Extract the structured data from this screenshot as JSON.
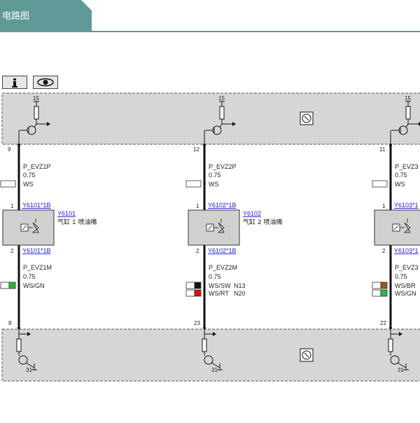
{
  "header": {
    "title": "电路图",
    "bar_color": "#5f9a98"
  },
  "toolbar": {
    "info_button": "i",
    "view_button": "eye-icon"
  },
  "top_module": {
    "supply_label": "15"
  },
  "bottom_module": {
    "ground_label": "31"
  },
  "circuits": [
    {
      "top_pin": "9",
      "wire_top_name": "P_EVZ1P",
      "wire_top_size": "0.75",
      "wire_top_color": "WS",
      "conn_top_pin": "1",
      "conn_top_ref": "Y6101*1B",
      "comp_ref": "Y6101",
      "comp_desc": "气缸 1 喷油嘴",
      "conn_bot_pin": "2",
      "conn_bot_ref": "Y6101*1B",
      "wire_bot_name": "P_EVZ1M",
      "wire_bot_size": "0.75",
      "wire_bot_colors": [
        {
          "code": "WS/GN",
          "swatch": "#22bb33",
          "net": ""
        }
      ],
      "bot_pin": "8"
    },
    {
      "top_pin": "12",
      "wire_top_name": "P_EVZ2P",
      "wire_top_size": "0.75",
      "wire_top_color": "WS",
      "conn_top_pin": "1",
      "conn_top_ref": "Y6102*1B",
      "comp_ref": "Y6102",
      "comp_desc": "气缸 2 喷油嘴",
      "conn_bot_pin": "2",
      "conn_bot_ref": "Y6102*1B",
      "wire_bot_name": "P_EVZ2M",
      "wire_bot_size": "0.75",
      "wire_bot_colors": [
        {
          "code": "WS/SW",
          "swatch": "#111111",
          "net": "N13"
        },
        {
          "code": "WS/RT",
          "swatch": "#dd1111",
          "net": "N20"
        }
      ],
      "bot_pin": "23"
    },
    {
      "top_pin": "11",
      "wire_top_name": "P_EVZ3",
      "wire_top_size": "0.75",
      "wire_top_color": "WS",
      "conn_top_pin": "1",
      "conn_top_ref": "Y6103*1",
      "comp_ref": "",
      "comp_desc": "",
      "conn_bot_pin": "2",
      "conn_bot_ref": "Y6103*1",
      "wire_bot_name": "P_EVZ3",
      "wire_bot_size": "0.75",
      "wire_bot_colors": [
        {
          "code": "WS/BR",
          "swatch": "#8b5a2b",
          "net": ""
        },
        {
          "code": "WS/GN",
          "swatch": "#22bb33",
          "net": ""
        }
      ],
      "bot_pin": "22"
    }
  ]
}
